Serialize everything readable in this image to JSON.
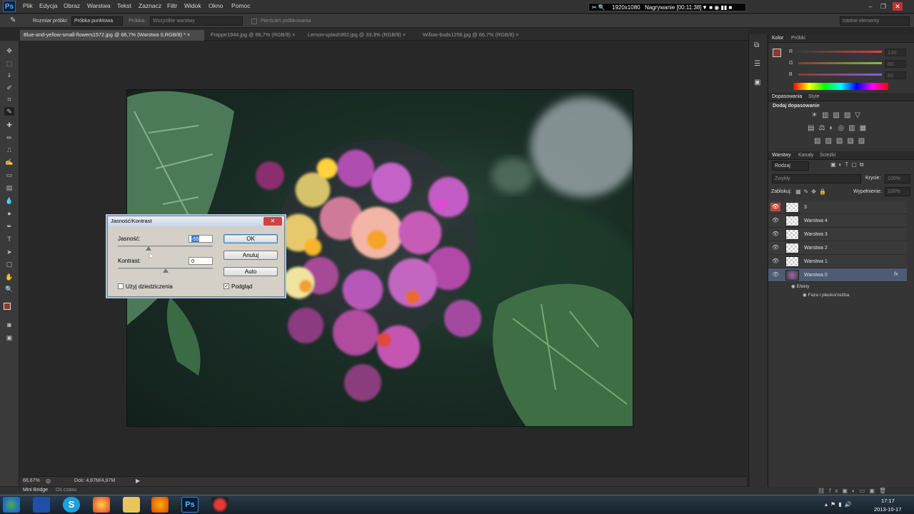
{
  "app": {
    "logo": "Ps"
  },
  "menu": [
    "Plik",
    "Edycja",
    "Obraz",
    "Warstwa",
    "Tekst",
    "Zaznacz",
    "Filtr",
    "Widok",
    "Okno",
    "Pomoc"
  ],
  "recorder": {
    "resolution": "1920x1080",
    "status": "Nagrywanie [00:11:38]"
  },
  "options": {
    "sample_size_label": "Rozmiar próbki:",
    "sample_size_value": "Próbka punktowa",
    "sample_label": "Próbka:",
    "sample_value": "Wszystkie warstwy",
    "ring_label": "Pierścień próbkowania",
    "workspace": "Istotne elementy"
  },
  "tabs": [
    {
      "label": "Blue-and-yellow-small-flowers1572.jpg @ 66,7% (Warstwa 0,RGB/8) *",
      "active": true
    },
    {
      "label": "Frappe1944.jpg @ 66,7% (RGB/8)",
      "active": false
    },
    {
      "label": "Lemon-splash992.jpg @ 33,3% (RGB/8)",
      "active": false
    },
    {
      "label": "Willow-buds1256.jpg @ 66,7% (RGB/8)",
      "active": false
    }
  ],
  "dialog": {
    "title": "Jasność/Kontrast",
    "brightness_label": "Jasność:",
    "brightness_value": "-55",
    "contrast_label": "Kontrast:",
    "contrast_value": "0",
    "ok": "OK",
    "cancel": "Anuluj",
    "auto": "Auto",
    "legacy_label": "Użyj dziedziczenia",
    "legacy_checked": false,
    "preview_label": "Podgląd",
    "preview_checked": true
  },
  "status": {
    "zoom": "66,67%",
    "doc": "Dok: 4,87M/4,87M"
  },
  "minibridge": {
    "tab1": "Mini Bridge",
    "tab2": "Oś czasu"
  },
  "color_panel": {
    "tabs": [
      "Kolor",
      "Próbki"
    ],
    "channels": [
      {
        "name": "R",
        "value": "130"
      },
      {
        "name": "G",
        "value": "60"
      },
      {
        "name": "B",
        "value": "60"
      }
    ]
  },
  "adjust_panel": {
    "tabs": [
      "Dopasowania",
      "Style"
    ],
    "title": "Dodaj dopasowanie"
  },
  "layers_panel": {
    "tabs": [
      "Warstwy",
      "Kanały",
      "Ścieżki"
    ],
    "kind": "Rodzaj",
    "blend": "Zwykły",
    "opacity_label": "Krycie:",
    "opacity_value": "100%",
    "lock_label": "Zablokuj:",
    "fill_label": "Wypełnienie:",
    "fill_value": "100%",
    "layers": [
      {
        "name": "3",
        "selected": false
      },
      {
        "name": "Warstwa 4",
        "selected": false
      },
      {
        "name": "Warstwa 3",
        "selected": false
      },
      {
        "name": "Warstwa 2",
        "selected": false
      },
      {
        "name": "Warstwa 1",
        "selected": false
      },
      {
        "name": "Warstwa 0",
        "selected": true
      }
    ],
    "effects_label": "Efekty",
    "effect_name": "Faza i płaskorzeźba"
  },
  "tray": {
    "time": "17:17",
    "date": "2013-10-17"
  },
  "colors": {
    "accent": "#4d5c74",
    "foreground": "#8b3a2e",
    "background": "#1a1a1a"
  }
}
